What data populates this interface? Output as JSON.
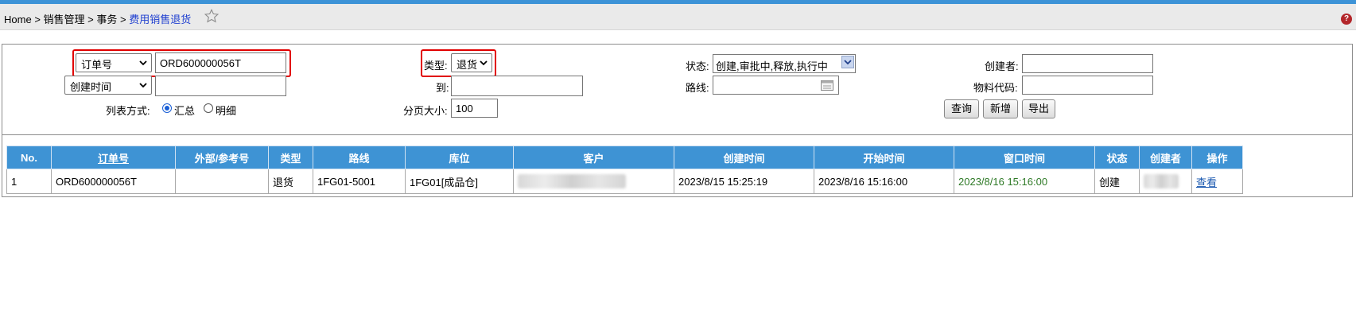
{
  "breadcrumb": {
    "home": "Home",
    "sep": ">",
    "level1": "销售管理",
    "level2": "事务",
    "current": "费用销售退货"
  },
  "filters": {
    "order_field_select": "订单号",
    "order_number_value": "ORD600000056T",
    "time_field_select": "创建时间",
    "time_from_value": "",
    "list_mode_label": "列表方式:",
    "list_mode_options": [
      "汇总",
      "明细"
    ],
    "list_mode_selected": "汇总",
    "type_label": "类型:",
    "type_value": "退货",
    "to_label": "到:",
    "to_value": "",
    "page_size_label": "分页大小:",
    "page_size_value": "100",
    "status_label": "状态:",
    "status_value": "创建,审批中,释放,执行中",
    "route_label": "路线:",
    "route_value": "",
    "creator_label": "创建者:",
    "creator_value": "",
    "material_label": "物料代码:",
    "material_value": "",
    "buttons": {
      "query": "查询",
      "add": "新增",
      "export": "导出"
    }
  },
  "table": {
    "columns": [
      "No.",
      "订单号",
      "外部/参考号",
      "类型",
      "路线",
      "库位",
      "客户",
      "创建时间",
      "开始时间",
      "窗口时间",
      "状态",
      "创建者",
      "操作"
    ],
    "rows": [
      {
        "no": "1",
        "order": "ORD600000056T",
        "ref": "",
        "type": "退货",
        "route": "1FG01-5001",
        "location": "1FG01[成品仓]",
        "customer": "",
        "created": "2023/8/15 15:25:19",
        "start": "2023/8/16 15:16:00",
        "window": "2023/8/16 15:16:00",
        "status": "创建",
        "creator": "",
        "action": "查看"
      }
    ]
  },
  "colors": {
    "header_blue": "#3e93d4",
    "highlight_red": "#e10000",
    "window_time_green": "#2f7a27",
    "link_blue": "#1a58b0"
  },
  "icons": [
    "star-icon",
    "help-icon",
    "chevron-down-icon",
    "calendar-icon",
    "dropdown-arrow-icon"
  ]
}
